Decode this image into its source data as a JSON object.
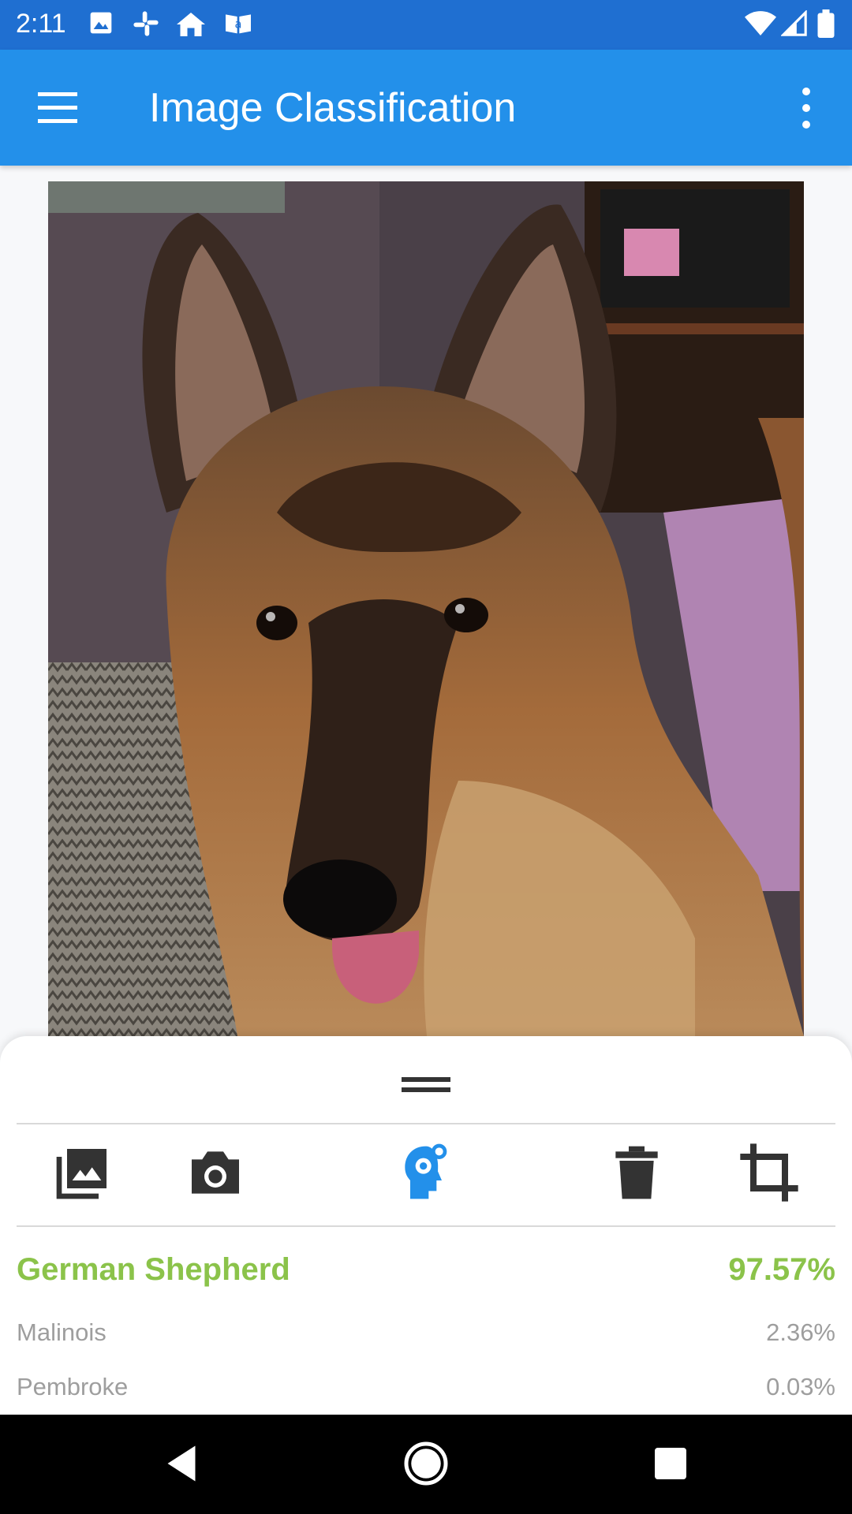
{
  "status_bar": {
    "time": "2:11",
    "notification_icons": [
      "image-icon",
      "slack-icon",
      "home-icon",
      "amazon-kindle-icon"
    ],
    "system_icons": [
      "wifi-icon",
      "signal-icon",
      "battery-icon"
    ]
  },
  "app_bar": {
    "title": "Image Classification",
    "menu_icon": "hamburger-menu-icon",
    "overflow_icon": "more-vertical-icon"
  },
  "photo": {
    "subject": "dog-photo"
  },
  "toolbar": {
    "buttons": [
      {
        "name": "gallery-button",
        "icon": "photo-library-icon"
      },
      {
        "name": "camera-button",
        "icon": "camera-icon"
      },
      {
        "name": "classify-button",
        "icon": "head-gear-icon",
        "active": true
      },
      {
        "name": "delete-button",
        "icon": "trash-icon"
      },
      {
        "name": "crop-button",
        "icon": "crop-icon"
      }
    ],
    "active_color": "#2390ea",
    "icon_color": "#333333"
  },
  "results": [
    {
      "label": "German Shepherd",
      "confidence": "97.57%",
      "highlight": true
    },
    {
      "label": "Malinois",
      "confidence": "2.36%",
      "highlight": false
    },
    {
      "label": "Pembroke",
      "confidence": "0.03%",
      "highlight": false
    }
  ],
  "colors": {
    "status_bar": "#1f6fd1",
    "app_bar": "#2390ea",
    "top_result": "#8bc34a",
    "other_results": "#9e9e9e"
  },
  "nav_bar": {
    "buttons": [
      "back-icon",
      "home-circle-icon",
      "recents-square-icon"
    ]
  }
}
